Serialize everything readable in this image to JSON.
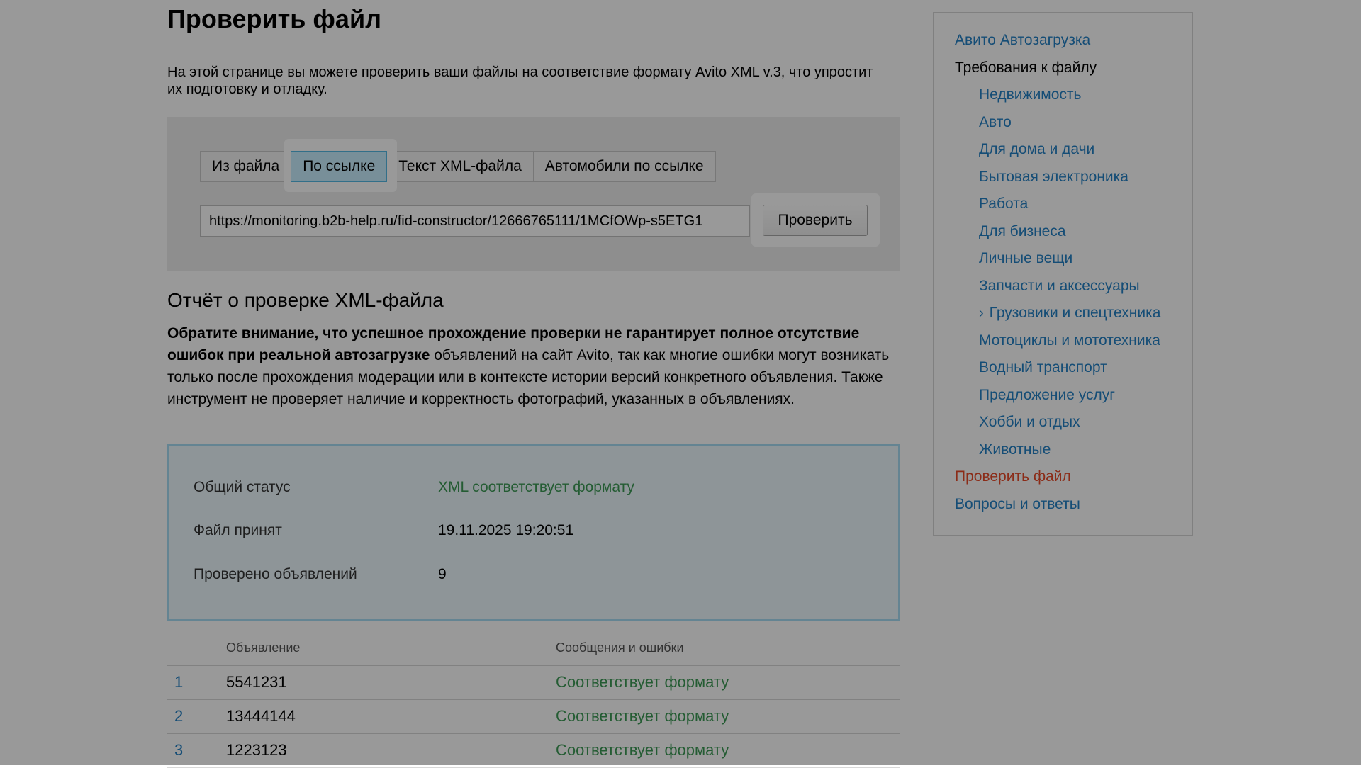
{
  "page": {
    "title": "Проверить файл",
    "intro": "На этой странице вы можете проверить ваши файлы на соответствие формату Avito XML v.3, что упростит их подготовку и отладку."
  },
  "tabs": [
    {
      "label": "Из файла",
      "active": false
    },
    {
      "label": "По ссылке",
      "active": true
    },
    {
      "label": "Текст XML-файла",
      "active": false
    },
    {
      "label": "Автомобили по ссылке",
      "active": false
    }
  ],
  "url_input": {
    "value": "https://monitoring.b2b-help.ru/fid-constructor/12666765111/1MCfOWp-s5ETG1"
  },
  "check_button": {
    "label": "Проверить"
  },
  "report": {
    "title": "Отчёт о проверке XML-файла",
    "notice_bold": "Обратите внимание, что успешное прохождение проверки не гарантирует полное отсутствие ошибок при реальной автозагрузке",
    "notice_rest": " объявлений на сайт Avito, так как многие ошибки могут возникать только после прохождения модерации или в контексте истории версий конкретного объявления. Также инструмент не проверяет наличие и корректность фотографий, указанных в объявлениях."
  },
  "status": {
    "overall_label": "Общий статус",
    "overall_value": "XML соответствует формату",
    "accepted_label": "Файл принят",
    "accepted_value": "19.11.2025 19:20:51",
    "checked_label": "Проверено объявлений",
    "checked_value": "9"
  },
  "results": {
    "col_ad": "Объявление",
    "col_msg": "Сообщения и ошибки",
    "rows": [
      {
        "num": "1",
        "ad": "5541231",
        "msg": "Соответствует формату"
      },
      {
        "num": "2",
        "ad": "13444144",
        "msg": "Соответствует формату"
      },
      {
        "num": "3",
        "ad": "1223123",
        "msg": "Соответствует формату"
      }
    ]
  },
  "sidebar": {
    "items": [
      {
        "label": "Авито Автозагрузка"
      },
      {
        "label": "Требования к файлу"
      },
      {
        "label": "Недвижимость"
      },
      {
        "label": "Авто"
      },
      {
        "label": "Для дома и дачи"
      },
      {
        "label": "Бытовая электроника"
      },
      {
        "label": "Работа"
      },
      {
        "label": "Для бизнеса"
      },
      {
        "label": "Личные вещи"
      },
      {
        "label": "Запчасти и аксессуары"
      },
      {
        "label": "Грузовики и спецтехника",
        "icon": "chevron-right-icon"
      },
      {
        "label": "Мотоциклы и мототехника"
      },
      {
        "label": "Водный транспорт"
      },
      {
        "label": "Предложение услуг"
      },
      {
        "label": "Хобби и отдых"
      },
      {
        "label": "Животные"
      },
      {
        "label": "Проверить файл"
      },
      {
        "label": "Вопросы и ответы"
      }
    ]
  },
  "colors": {
    "link": "#2481c5",
    "success": "#3c9a55",
    "current": "#e84a28",
    "active_tab": "#c9efff"
  }
}
